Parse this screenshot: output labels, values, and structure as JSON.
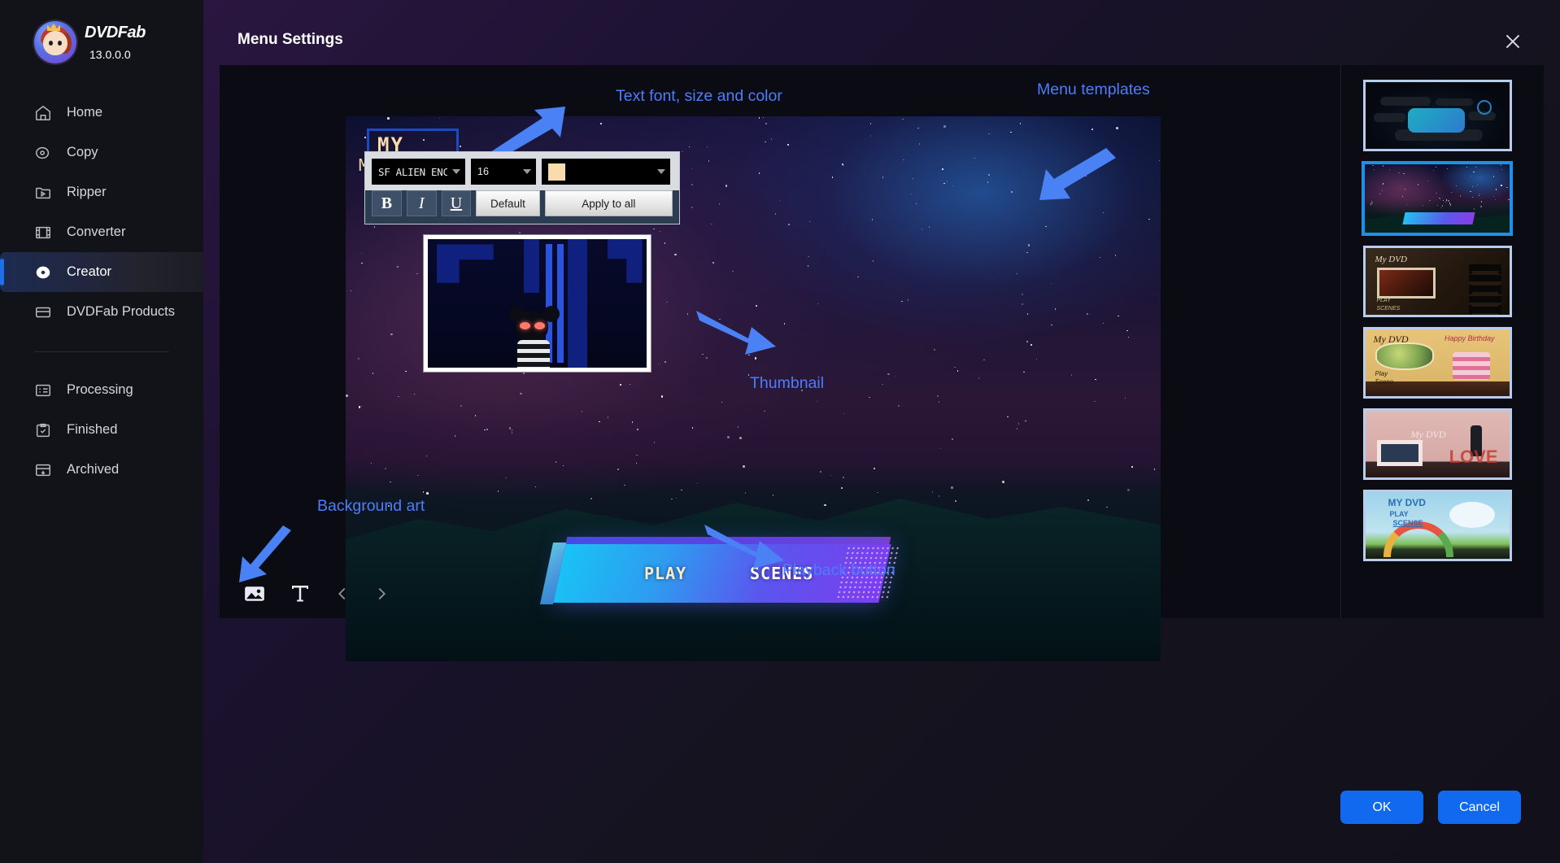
{
  "app": {
    "brand_name": "DVDFab",
    "version": "13.0.0.0"
  },
  "sidebar": {
    "items": [
      {
        "label": "Home",
        "icon": "home-icon"
      },
      {
        "label": "Copy",
        "icon": "copy-disc-icon"
      },
      {
        "label": "Ripper",
        "icon": "ripper-folder-icon"
      },
      {
        "label": "Converter",
        "icon": "film-strip-icon"
      },
      {
        "label": "Creator",
        "icon": "disc-icon"
      },
      {
        "label": "DVDFab Products",
        "icon": "box-icon"
      }
    ],
    "secondary_items": [
      {
        "label": "Processing",
        "icon": "list-icon"
      },
      {
        "label": "Finished",
        "icon": "clipboard-check-icon"
      },
      {
        "label": "Archived",
        "icon": "archive-icon"
      }
    ]
  },
  "dialog": {
    "title": "Menu Settings",
    "close_icon": "close-icon",
    "ok_label": "OK",
    "cancel_label": "Cancel"
  },
  "preview": {
    "dvd_title": "MY DVD",
    "play_label": "PLAY",
    "scenes_label": "SCENES"
  },
  "font_toolbar": {
    "font_family_value": "SF ALIEN ENCOUI",
    "font_size_value": "16",
    "color_value": "#f8dcae",
    "bold_label": "B",
    "italic_label": "I",
    "underline_label": "U",
    "default_label": "Default",
    "apply_all_label": "Apply to all"
  },
  "toolstrip": {
    "items": [
      {
        "name": "image-icon"
      },
      {
        "name": "text-icon"
      },
      {
        "name": "chevron-left-icon"
      },
      {
        "name": "chevron-right-icon"
      }
    ]
  },
  "annotations": [
    {
      "id": "text-font",
      "text": "Text font, size and color"
    },
    {
      "id": "menu-templates",
      "text": "Menu templates"
    },
    {
      "id": "thumbnail",
      "text": "Thumbnail"
    },
    {
      "id": "background-art",
      "text": "Background art"
    },
    {
      "id": "playback-button",
      "text": "Playback button"
    }
  ],
  "templates": [
    {
      "id": "tmpl-scifi",
      "selected": false
    },
    {
      "id": "tmpl-galaxy",
      "selected": true
    },
    {
      "id": "tmpl-film",
      "title": "My DVD",
      "play": "PLAY",
      "scenes": "SCENES",
      "selected": false
    },
    {
      "id": "tmpl-birthday",
      "title": "My DVD",
      "play": "Play",
      "scenes": "Scene",
      "badge": "Happy Birthday",
      "selected": false
    },
    {
      "id": "tmpl-wedding",
      "title": "My DVD",
      "love": "LOVE",
      "selected": false
    },
    {
      "id": "tmpl-kids",
      "title": "MY DVD",
      "play": "PLAY",
      "scenes": "SCENSE",
      "selected": false
    }
  ],
  "colors": {
    "accent": "#1169f0",
    "annotation": "#4d7dfb",
    "selected_border": "#1f8fe8",
    "title_text": "#f8dcae"
  }
}
